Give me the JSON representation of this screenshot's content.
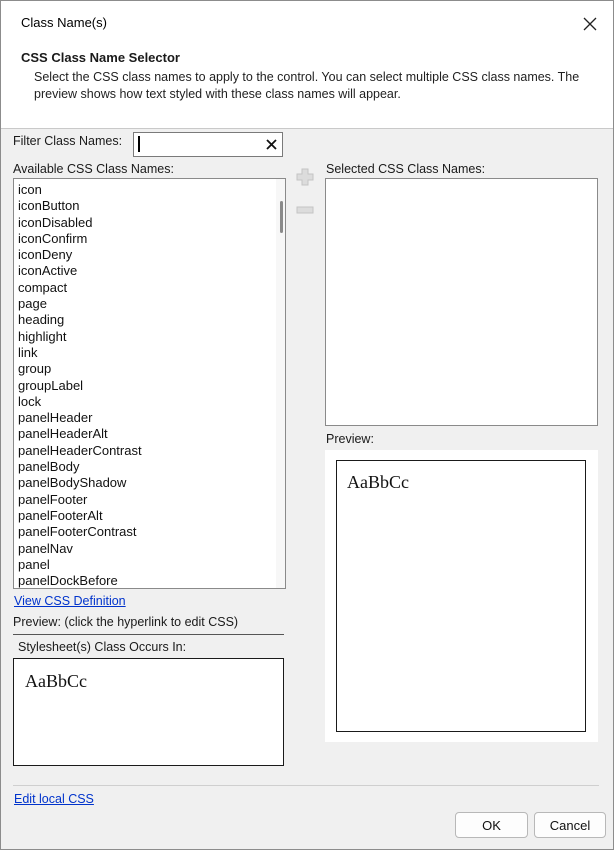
{
  "window": {
    "title": "Class Name(s)"
  },
  "header": {
    "title": "CSS Class Name Selector",
    "description": "Select the CSS class names to apply to the control. You can select multiple CSS class names. The preview shows how text styled with these class names will appear."
  },
  "filter": {
    "label": "Filter Class Names:",
    "value": ""
  },
  "available": {
    "label": "Available CSS Class Names:",
    "items": [
      "icon",
      "iconButton",
      "iconDisabled",
      "iconConfirm",
      "iconDeny",
      "iconActive",
      "compact",
      "page",
      "heading",
      "highlight",
      "link",
      "group",
      "groupLabel",
      "lock",
      "panelHeader",
      "panelHeaderAlt",
      "panelHeaderContrast",
      "panelBody",
      "panelBodyShadow",
      "panelFooter",
      "panelFooterAlt",
      "panelFooterContrast",
      "panelNav",
      "panel",
      "panelDockBefore"
    ]
  },
  "selected": {
    "label": "Selected CSS Class Names:"
  },
  "links": {
    "view_css": "View CSS Definition",
    "edit_local_css": "Edit local CSS"
  },
  "left_preview": {
    "label": "Preview: (click the hyperlink to edit CSS)",
    "sheet_label": "Stylesheet(s) Class Occurs In:",
    "sample": "AaBbCc"
  },
  "right_preview": {
    "label": "Preview:",
    "sample": "AaBbCc"
  },
  "buttons": {
    "ok": "OK",
    "cancel": "Cancel"
  },
  "colors": {
    "link": "#0033cc",
    "window_bg": "#f0f0f0",
    "header_bg": "#ffffff"
  }
}
